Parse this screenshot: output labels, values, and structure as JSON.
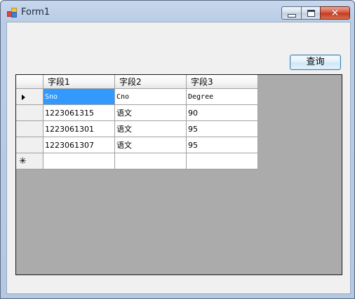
{
  "window": {
    "title": "Form1",
    "minimize_label": "minimize",
    "maximize_label": "maximize",
    "close_label": "close"
  },
  "toolbar": {
    "query_label": "查询"
  },
  "grid": {
    "columns": [
      "字段1",
      "字段2",
      "字段3"
    ],
    "rows": [
      [
        "Sno",
        "Cno",
        "Degree"
      ],
      [
        "1223061315",
        "语文",
        "90"
      ],
      [
        "1223061301",
        "语文",
        "95"
      ],
      [
        "1223061307",
        "语文",
        "95"
      ]
    ],
    "current_row_indicator": "arrow-right-icon",
    "new_row_indicator": "✳"
  },
  "colors": {
    "selection": "#3399ff",
    "grid_background": "#ababab",
    "client_background": "#f0f0f0"
  }
}
